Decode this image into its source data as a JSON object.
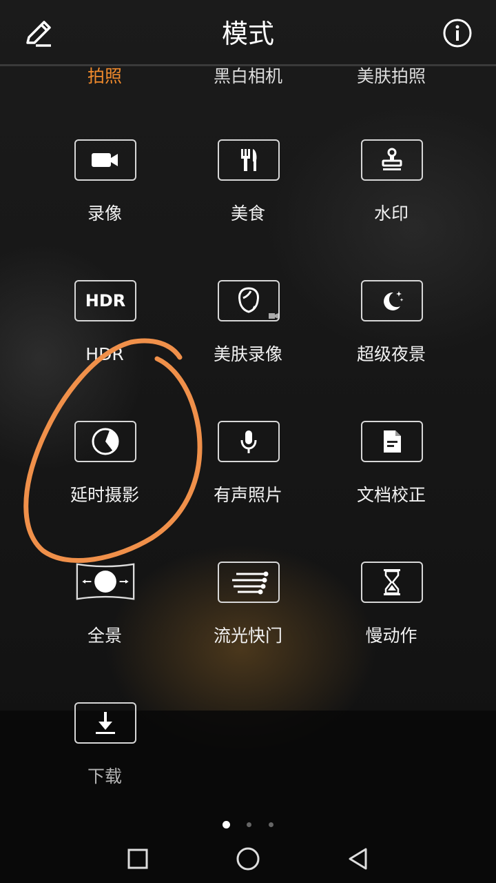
{
  "header": {
    "title": "模式",
    "edit_icon": "pencil-icon",
    "info_icon": "info-icon"
  },
  "top_modes": [
    {
      "label": "拍照",
      "active": true
    },
    {
      "label": "黑白相机",
      "active": false
    },
    {
      "label": "美肤拍照",
      "active": false
    }
  ],
  "modes": [
    {
      "label": "录像",
      "icon": "video-camera-icon"
    },
    {
      "label": "美食",
      "icon": "fork-knife-icon"
    },
    {
      "label": "水印",
      "icon": "stamp-icon"
    },
    {
      "label": "HDR",
      "icon": "hdr-icon",
      "icon_text": "HDR"
    },
    {
      "label": "美肤录像",
      "icon": "beauty-video-icon"
    },
    {
      "label": "超级夜景",
      "icon": "moon-stars-icon"
    },
    {
      "label": "延时摄影",
      "icon": "timelapse-icon"
    },
    {
      "label": "有声照片",
      "icon": "microphone-icon"
    },
    {
      "label": "文档校正",
      "icon": "document-icon"
    },
    {
      "label": "全景",
      "icon": "panorama-icon"
    },
    {
      "label": "流光快门",
      "icon": "light-trail-icon"
    },
    {
      "label": "慢动作",
      "icon": "hourglass-icon"
    },
    {
      "label": "下载",
      "icon": "download-icon"
    }
  ],
  "pager": {
    "pages": 3,
    "current": 1
  },
  "navbar": {
    "recents_icon": "square-recents-icon",
    "home_icon": "circle-home-icon",
    "back_icon": "triangle-back-icon"
  },
  "colors": {
    "accent": "#f08a2c",
    "annotation": "#f0904a"
  }
}
